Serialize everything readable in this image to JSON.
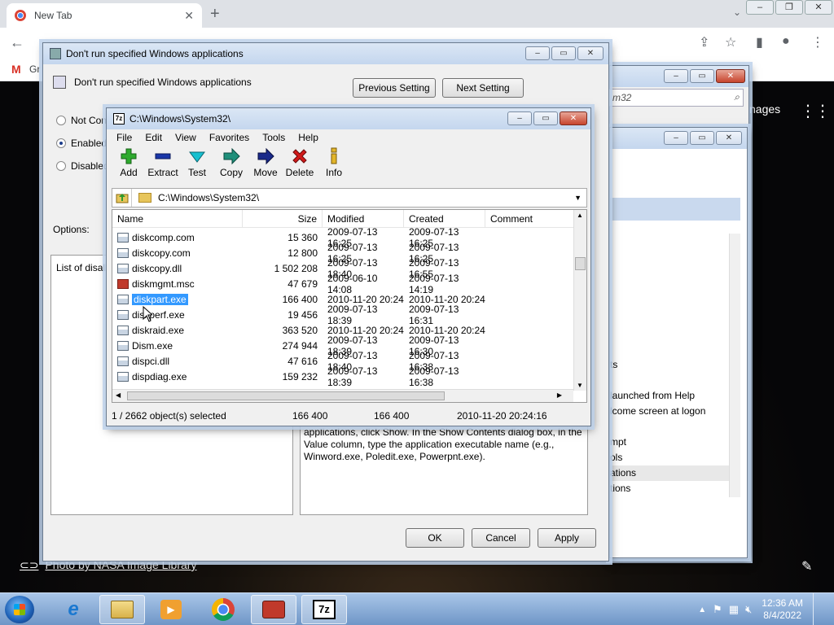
{
  "browser": {
    "tab_title": "New Tab",
    "new_tab": "+",
    "bookmark_gmail": "Gr",
    "images_link": "nages",
    "photo_credit": "Photo by NASA Image Library"
  },
  "gp_window": {
    "title": "Don't run specified Windows applications",
    "header": "Don't run specified Windows applications",
    "prev_button": "Previous Setting",
    "next_button": "Next Setting",
    "radios": [
      {
        "label": "Not Con",
        "checked": false
      },
      {
        "label": "Enabled",
        "checked": true
      },
      {
        "label": "Disabled",
        "checked": false
      }
    ],
    "options_label": "Options:",
    "list_label": "List of disall",
    "help_text_1": "applications, click Show. In the Show Contents dialog box, in the",
    "help_text_2": "Value column, type the application executable name (e.g.,",
    "help_text_3": "Winword.exe, Poledit.exe, Powerpnt.exe).",
    "ok": "OK",
    "cancel": "Cancel",
    "apply": "Apply"
  },
  "back_window": {
    "search_text": "m32",
    "items": [
      "ts",
      "launched from Help",
      "lcome screen at logon",
      "mpt",
      "ols",
      "ations",
      "tions"
    ]
  },
  "zip_window": {
    "title": "C:\\Windows\\System32\\",
    "menu": [
      "File",
      "Edit",
      "View",
      "Favorites",
      "Tools",
      "Help"
    ],
    "tools": [
      {
        "label": "Add",
        "icon": "plus-icon",
        "color": "#2eaa2e"
      },
      {
        "label": "Extract",
        "icon": "minus-icon",
        "color": "#1a36a8"
      },
      {
        "label": "Test",
        "icon": "check-icon",
        "color": "#17a2b8"
      },
      {
        "label": "Copy",
        "icon": "copy-arrow-icon",
        "color": "#1f8f7a"
      },
      {
        "label": "Move",
        "icon": "move-arrow-icon",
        "color": "#1a2a8a"
      },
      {
        "label": "Delete",
        "icon": "x-icon",
        "color": "#d11a1a"
      },
      {
        "label": "Info",
        "icon": "info-icon",
        "color": "#c9a21a"
      }
    ],
    "path": "C:\\Windows\\System32\\",
    "columns": [
      "Name",
      "Size",
      "Modified",
      "Created",
      "Comment"
    ],
    "rows": [
      {
        "name": "diskcomp.com",
        "size": "15 360",
        "modified": "2009-07-13 16:25",
        "created": "2009-07-13 16:25",
        "type": "exe"
      },
      {
        "name": "diskcopy.com",
        "size": "12 800",
        "modified": "2009-07-13 16:25",
        "created": "2009-07-13 16:25",
        "type": "exe"
      },
      {
        "name": "diskcopy.dll",
        "size": "1 502 208",
        "modified": "2009-07-13 18:40",
        "created": "2009-07-13 16:55",
        "type": "dll"
      },
      {
        "name": "diskmgmt.msc",
        "size": "47 679",
        "modified": "2009-06-10 14:08",
        "created": "2009-07-13 14:19",
        "type": "msc"
      },
      {
        "name": "diskpart.exe",
        "size": "166 400",
        "modified": "2010-11-20 20:24",
        "created": "2010-11-20 20:24",
        "type": "exe",
        "selected": true
      },
      {
        "name": "diskperf.exe",
        "size": "19 456",
        "modified": "2009-07-13 18:39",
        "created": "2009-07-13 16:31",
        "type": "exe"
      },
      {
        "name": "diskraid.exe",
        "size": "363 520",
        "modified": "2010-11-20 20:24",
        "created": "2010-11-20 20:24",
        "type": "exe"
      },
      {
        "name": "Dism.exe",
        "size": "274 944",
        "modified": "2009-07-13 18:39",
        "created": "2009-07-13 16:30",
        "type": "exe"
      },
      {
        "name": "dispci.dll",
        "size": "47 616",
        "modified": "2009-07-13 18:40",
        "created": "2009-07-13 16:38",
        "type": "dll"
      },
      {
        "name": "dispdiag.exe",
        "size": "159 232",
        "modified": "2009-07-13 18:39",
        "created": "2009-07-13 16:38",
        "type": "exe"
      }
    ],
    "status": {
      "selected": "1 / 2662 object(s) selected",
      "size": "166 400",
      "packed": "166 400",
      "date": "2010-11-20 20:24:16"
    }
  },
  "taskbar": {
    "time": "12:36 AM",
    "date": "8/4/2022"
  }
}
